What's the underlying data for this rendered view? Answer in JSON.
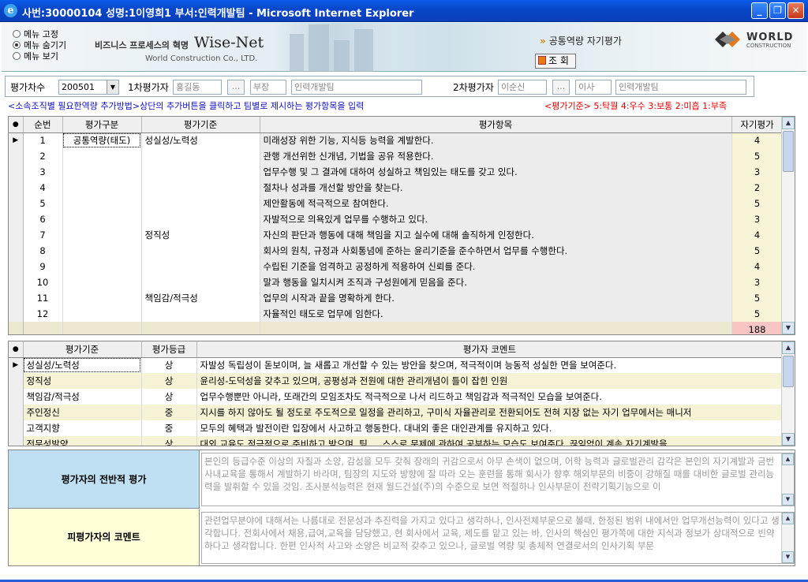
{
  "window": {
    "title": "사번:30000104 성명:1이영희1 부서:인력개발팀 - Microsoft Internet Explorer"
  },
  "menu": {
    "options": [
      "메뉴 고정",
      "메뉴 숨기기",
      "메뉴 보기"
    ],
    "selected": "메뉴 숨기기"
  },
  "brand": {
    "slogan": "비즈니스 프로세스의 혁명",
    "name": "Wise-Net",
    "company": "World Construction Co., LTD."
  },
  "page": {
    "breadcrumb": "공통역량 자기평가",
    "inquire_button": "조 회"
  },
  "logo": {
    "title": "WORLD",
    "subtitle": "CONSTRUCTION"
  },
  "filter": {
    "period_label": "평가차수",
    "period_value": "200501",
    "eval1_label": "1차평가자",
    "eval1_name": "홍길동",
    "eval1_position": "부장",
    "eval1_dept": "인력개발팀",
    "eval2_label": "2차평가자",
    "eval2_name": "이순신",
    "eval2_position": "이사",
    "eval2_dept": "인력개발팀",
    "dots": "..."
  },
  "note": "<소속조직별 필요한역량 추가방법>상단의 추가버튼을 클릭하고 팀별로 제시하는 평가항목을 입력",
  "legend": "<평가기준> 5:탁월 4:우수 3:보통 2:미흡 1:부족",
  "grid1": {
    "headers": [
      "순번",
      "평가구분",
      "평가기준",
      "평가항목",
      "자기평가"
    ],
    "rows": [
      {
        "no": "1",
        "type": "공통역량(태도)",
        "criterion": "성실성/노력성",
        "item": "미래성장 위한 기능, 지식등 능력을 계발한다.",
        "score": "4"
      },
      {
        "no": "2",
        "type": "",
        "criterion": "",
        "item": "관행 개선위한 신개념, 기법을 공유 적용한다.",
        "score": "5"
      },
      {
        "no": "3",
        "type": "",
        "criterion": "",
        "item": "업무수행 및 그 결과에 대하여 성실하고 책임있는 태도를 갖고 있다.",
        "score": "3"
      },
      {
        "no": "4",
        "type": "",
        "criterion": "",
        "item": "절차나 성과를 개선할 방안을 찾는다.",
        "score": "2"
      },
      {
        "no": "5",
        "type": "",
        "criterion": "",
        "item": "제안활동에 적극적으로 참여한다.",
        "score": "5"
      },
      {
        "no": "6",
        "type": "",
        "criterion": "",
        "item": "자발적으로 의욕있게 업무를 수행하고 있다.",
        "score": "3"
      },
      {
        "no": "7",
        "type": "",
        "criterion": "정직성",
        "item": "자신의 판단과 행동에 대해 책임을 지고 실수에 대해 솔직하게 인정한다.",
        "score": "4"
      },
      {
        "no": "8",
        "type": "",
        "criterion": "",
        "item": "회사의 원칙, 규정과 사회통념에 준하는 윤리기준을 준수하면서 업무를 수행한다.",
        "score": "5"
      },
      {
        "no": "9",
        "type": "",
        "criterion": "",
        "item": "수립된 기준을 엄격하고 공정하게 적용하여 신뢰를 준다.",
        "score": "4"
      },
      {
        "no": "10",
        "type": "",
        "criterion": "",
        "item": "말과 행동을 일치시켜 조직과 구성원에게 믿음을 준다.",
        "score": "3"
      },
      {
        "no": "11",
        "type": "",
        "criterion": "책임감/적극성",
        "item": "업무의 시작과 끝을 명확하게 한다.",
        "score": "5"
      },
      {
        "no": "12",
        "type": "",
        "criterion": "",
        "item": "자율적인 태도로 업무에 임한다.",
        "score": "5"
      }
    ],
    "total": "188"
  },
  "grid2": {
    "headers": [
      "평가기준",
      "평가등급",
      "평가자 코멘트"
    ],
    "rows": [
      {
        "criterion": "성실성/노력성",
        "grade": "상",
        "comment": "자발성 독립성이 돋보이며, 늘 새롭고 개선할 수 있는 방안을 찾으며, 적극적이며 능동적 성실한 면을 보여준다."
      },
      {
        "criterion": "정직성",
        "grade": "상",
        "comment": "윤리성-도덕성을 갖추고 있으며, 공평성과 전원에 대한 관리개념이 틀이 잡힌 인원"
      },
      {
        "criterion": "책임감/적극성",
        "grade": "상",
        "comment": "업무수행뿐만 아니라, 또래간의 모임조차도 적극적으로 나서 리드하고 책임감과 적극적인 모습을 보여준다."
      },
      {
        "criterion": "주인정신",
        "grade": "중",
        "comment": "지시를 하지 않아도 될 정도로 주도적으로 일정을 관리하고, 구미식 자율관리로 전환되어도 전혀 지장 없는 자기 업무에서는 매니저"
      },
      {
        "criterion": "고객지향",
        "grade": "중",
        "comment": "모두의 혜택과 발전이란 입장에서 사고하고 행동한다. 대내외 좋은 대인관계를 유지하고 있다."
      },
      {
        "criterion": "전문성발양",
        "grade": "상",
        "comment": "대외 교육도 적극적으로 준비하고 받으며, 팀 … 스스로 문제에 관하여 공부하는 모습도 보여준다. 끊임없이 계속 자기계발을"
      }
    ]
  },
  "bottom": {
    "overall_label": "평가자의 전반적 평가",
    "overall_text": "본인의 등급수준 이상의 자질과 소양, 감성을 모두 갖춰 장래의 귀감으로서 아무 손색이 없으며, 어학 능력과 글로벌관리 감각은 본인의 자기계발과 금번 사내교육을 통해서 계발하기 바라며, 팀장의 지도와 방향에 잘 따라 오는 훈련을 통해 회사가 향후 해외부문의 비중이 강해질 때를 대비한 글로벌 관리능력을 발휘할 수 있을 것임. 조사분석능력은 현재 월드건설(주)의 수준으로 보면 적절하나 인사부문이 전략기획기능으로 이",
    "self_label": "피평가자의 코멘트",
    "self_text": "관련업무분야에 대해서는 나름대로 전문성과 추진력을 가지고 있다고 생각하나, 인사전체부문으로 볼때, 한정된 범위 내에서만 업무개선능력이 있다고 생각합니다. 전회사에서 채용,급여,교육을 담당했고, 현 회사에서 교육, 제도를 맡고 있는 바, 인사의 핵심인 평가쪽에 대한 지식과 정보가 상대적으로 빈약하다고 생각합니다. 한편 인사적 사고와 소양은 비교적 갖추고 있으나, 글로벌 역량 및 총체적 연결로서의 인사기획 부문"
  },
  "colors": {
    "title_bar": "#0846c8",
    "note": "#1010c0",
    "legend": "#e00000",
    "overall_label_bg": "#bfe0f2",
    "self_label_bg": "#ffffd8",
    "total_bg": "#f8c4c4"
  }
}
